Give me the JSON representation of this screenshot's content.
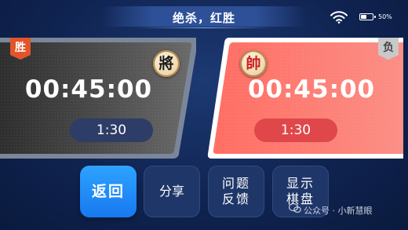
{
  "header": {
    "title": "绝杀，红胜",
    "battery_text": "50%",
    "battery_level": 0.5
  },
  "players": {
    "left": {
      "result_badge": "胜",
      "piece_char": "將",
      "clock": "00:45:00",
      "byoyomi": "1:30"
    },
    "right": {
      "result_badge": "负",
      "piece_char": "帥",
      "clock": "00:45:00",
      "byoyomi": "1:30"
    }
  },
  "buttons": {
    "back": "返回",
    "share": "分享",
    "feedback_line1": "问题",
    "feedback_line2": "反馈",
    "show_board_line1": "显示",
    "show_board_line2": "棋盘"
  },
  "watermark": {
    "text": "公众号 · 小新慧眼"
  },
  "colors": {
    "accent_blue": "#1778f0",
    "red_side": "#f25a5a",
    "win_badge": "#e2542a",
    "lose_badge": "#c9c9c9"
  },
  "icons": {
    "wifi": "wifi-icon",
    "battery": "battery-icon",
    "watermark": "wechat-icon"
  }
}
